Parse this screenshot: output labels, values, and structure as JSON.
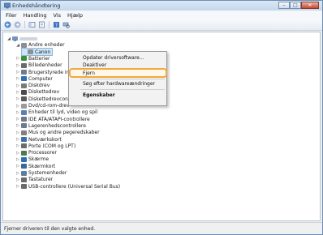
{
  "window": {
    "title": "Enhedshåndtering",
    "min_glyph": "–",
    "max_glyph": "□",
    "close_glyph": "✕"
  },
  "menu": [
    "Filer",
    "Handling",
    "Vis",
    "Hjælp"
  ],
  "toolbar": {
    "icons": [
      "back-arrow-icon",
      "forward-arrow-icon",
      "show-hide-icon",
      "properties-icon",
      "help-icon",
      "scan-hardware-icon"
    ]
  },
  "tree": {
    "root_label": "",
    "items": [
      {
        "label": "Andre enheder",
        "expanded": true,
        "icon": "unknown-device-icon",
        "color": "#8a8f96"
      },
      {
        "label": "Canon",
        "child": true,
        "icon": "canon-device-icon",
        "color": "#8a8f96"
      },
      {
        "label": "Batterier",
        "icon": "battery-icon",
        "color": "#3a8f3a"
      },
      {
        "label": "Billedenheder",
        "icon": "camera-icon",
        "color": "#6b6b6b"
      },
      {
        "label": "Brugerstyrede inp",
        "icon": "hid-icon",
        "color": "#6e7c8c"
      },
      {
        "label": "Computer",
        "icon": "computer-icon",
        "color": "#2f6fb3"
      },
      {
        "label": "Diskdrev",
        "icon": "disk-icon",
        "color": "#7a7a7a"
      },
      {
        "label": "Diskettedrev",
        "icon": "floppy-icon",
        "color": "#4a4a4a"
      },
      {
        "label": "Diskettedrevcontr",
        "icon": "floppy-controller-icon",
        "color": "#5a5a5a"
      },
      {
        "label": "Dvd/cd-rom-drev",
        "icon": "dvd-icon",
        "color": "#9a9a9a"
      },
      {
        "label": "Enheder til lyd, video og spil",
        "icon": "sound-icon",
        "color": "#5a7fb0"
      },
      {
        "label": "IDE ATA/ATAPI-controllere",
        "icon": "ide-icon",
        "color": "#6c7a8a"
      },
      {
        "label": "Lagerenhedscontrollere",
        "icon": "storage-icon",
        "color": "#6c7a8a"
      },
      {
        "label": "Mus og andre pegeredskaber",
        "icon": "mouse-icon",
        "color": "#808080"
      },
      {
        "label": "Netværkskort",
        "icon": "network-icon",
        "color": "#3b6ea8"
      },
      {
        "label": "Porte (COM og LPT)",
        "icon": "port-icon",
        "color": "#6b6b6b"
      },
      {
        "label": "Processorer",
        "icon": "processor-icon",
        "color": "#4f7a4f"
      },
      {
        "label": "Skærme",
        "icon": "monitor-icon",
        "color": "#2f6fb3"
      },
      {
        "label": "Skærmkort",
        "icon": "display-adapter-icon",
        "color": "#3a6a9a"
      },
      {
        "label": "Systemenheder",
        "icon": "system-icon",
        "color": "#5d7e9f"
      },
      {
        "label": "Tastaturer",
        "icon": "keyboard-icon",
        "color": "#6b6b6b"
      },
      {
        "label": "USB-controllere (Universal Serial Bus)",
        "icon": "usb-icon",
        "color": "#6b6b6b"
      }
    ]
  },
  "context_menu": {
    "items": [
      {
        "label": "Opdater driversoftware...",
        "bold": false
      },
      {
        "label": "Deaktiver",
        "bold": false
      },
      {
        "label": "Fjern",
        "bold": false,
        "highlighted": true
      },
      {
        "label": "Søg efter hardwareændringer",
        "bold": false
      },
      {
        "label": "Egenskaber",
        "bold": true
      }
    ],
    "highlight_color": "#f2a93b"
  },
  "status": {
    "text": "Fjerner driveren til den valgte enhed."
  }
}
